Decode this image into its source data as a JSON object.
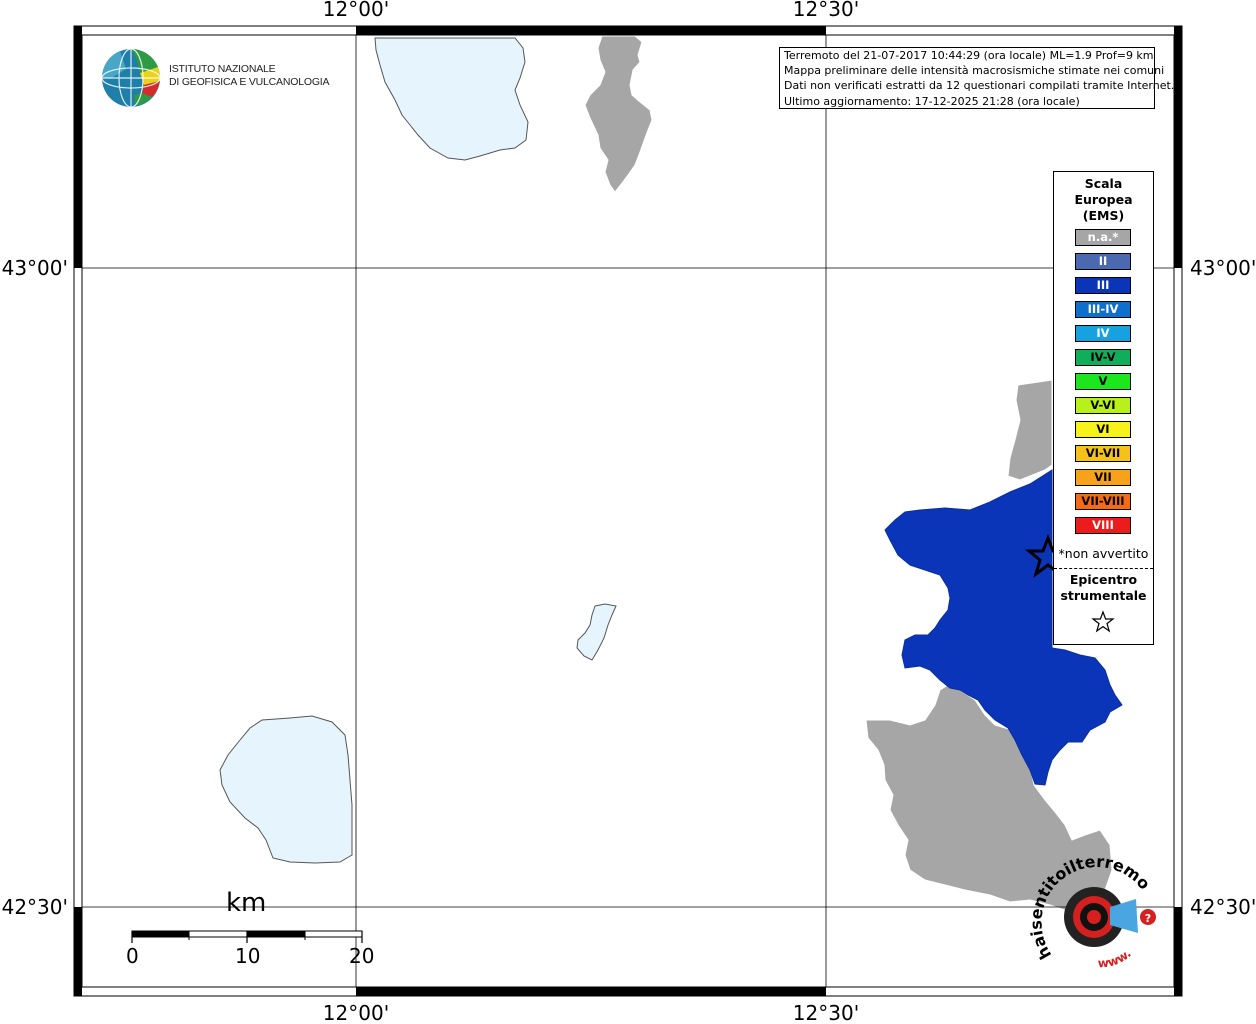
{
  "map": {
    "lon_ticks": [
      "12°00'",
      "12°30'"
    ],
    "lat_ticks": [
      "43°00'",
      "42°30'"
    ]
  },
  "logo": {
    "line1": "ISTITUTO NAZIONALE",
    "line2": "DI GEOFISICA E VULCANOLOGIA"
  },
  "info": {
    "line1": "Terremoto del 21-07-2017 10:44:29 (ora locale) ML=1.9 Prof=9 km",
    "line2": "Mappa preliminare delle intensità macrosismiche stimate nei comuni",
    "line3": "Dati non verificati estratti da 12 questionari compilati tramite Internet.",
    "line4": "Ultimo aggiornamento: 17-12-2025 21:28 (ora locale)"
  },
  "legend": {
    "title1": "Scala",
    "title2": "Europea",
    "title3": "(EMS)",
    "items": [
      {
        "label": "n.a.*",
        "color": "#a6a6a6",
        "text_color": "#ffffff"
      },
      {
        "label": "II",
        "color": "#4a69b0",
        "text_color": "#ffffff"
      },
      {
        "label": "III",
        "color": "#0a35b8",
        "text_color": "#ffffff"
      },
      {
        "label": "III-IV",
        "color": "#0e6fce",
        "text_color": "#ffffff"
      },
      {
        "label": "IV",
        "color": "#16a2e0",
        "text_color": "#ffffff"
      },
      {
        "label": "IV-V",
        "color": "#10ad5a",
        "text_color": "#000000"
      },
      {
        "label": "V",
        "color": "#1ce61c",
        "text_color": "#000000"
      },
      {
        "label": "V-VI",
        "color": "#b7f01b",
        "text_color": "#000000"
      },
      {
        "label": "VI",
        "color": "#f7f21a",
        "text_color": "#000000"
      },
      {
        "label": "VI-VII",
        "color": "#f6c21a",
        "text_color": "#000000"
      },
      {
        "label": "VII",
        "color": "#f7a21a",
        "text_color": "#000000"
      },
      {
        "label": "VII-VIII",
        "color": "#f36b12",
        "text_color": "#000000"
      },
      {
        "label": "VIII",
        "color": "#ed1c1c",
        "text_color": "#ffffff"
      }
    ],
    "note": "*non avvertito",
    "epi1": "Epicentro",
    "epi2": "strumentale"
  },
  "scale_bar": {
    "unit": "km",
    "labels": [
      "0",
      "10",
      "20"
    ]
  },
  "watermark": {
    "text": "haisentitoilterremoto.it",
    "url_prefix": "www."
  },
  "colors": {
    "lake": "#e6f4fd",
    "not_felt": "#a6a6a6",
    "intensity_iii": "#0a35b8"
  }
}
